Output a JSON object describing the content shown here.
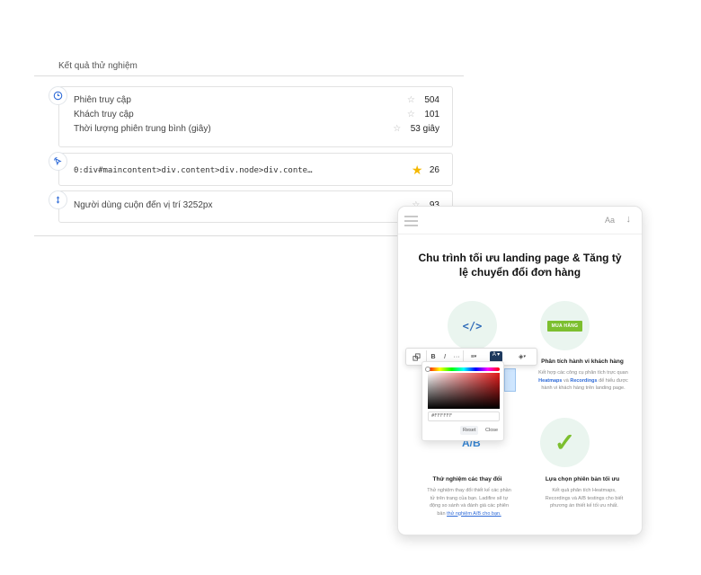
{
  "results": {
    "title": "Kết quả thử nghiệm",
    "card1": {
      "icon": "clock-icon",
      "rows": [
        {
          "label": "Phiên truy cập",
          "value": "504"
        },
        {
          "label": "Khách truy cập",
          "value": "101"
        },
        {
          "label": "Thời lượng phiên trung bình (giây)",
          "value": "53 giây"
        }
      ]
    },
    "card2": {
      "icon": "cursor-click-icon",
      "selector": "0:div#maincontent>div.content>div.node>div.conte…",
      "value": "26"
    },
    "card3": {
      "icon": "scroll-vertical-icon",
      "label": "Người dùng cuộn đến vị trí 3252px",
      "value": "93"
    }
  },
  "phone": {
    "font_size_label": "Aa",
    "title": "Chu trình tối ưu landing page & Tăng tỷ lệ chuyển đổi đơn hàng",
    "buy_badge": "MUA HÀNG",
    "features": [
      {
        "title": "Phân tích hành vi khách hàng",
        "desc_prefix": "Kết hợp các công cụ phân tích trực quan",
        "link1": "Heatmaps",
        "and": "và",
        "link2": "Recordings",
        "desc_suffix": "để hiểu được hành vi khách hàng trên landing page."
      },
      {
        "title": "Thử nghiệm các thay đổi",
        "desc": "Thử nghiệm thay đổi thiết kế các phần tử trên trang của bạn. Ladifire sẽ tự động so sánh và đánh giá các phiên bản",
        "link": "thử nghiệm A/B cho bạn."
      },
      {
        "title": "Lựa chọn phiên bản tối ưu",
        "desc": "Kết quả phân tích Heatmaps, Recordings và A/B testings cho biết phương án thiết kế tối ưu nhất."
      }
    ],
    "ab_label": "A/B"
  },
  "toolbar": {
    "bold": "B",
    "italic": "I",
    "more": "···",
    "align": "≡",
    "text_color": "A"
  },
  "picker": {
    "hex_value": "#FFFFFF",
    "reset": "Reset",
    "close": "Close"
  },
  "colors": {
    "accent_green": "#7cbf2f",
    "link_blue": "#2f6bd8",
    "star_gold": "#f5b800"
  }
}
